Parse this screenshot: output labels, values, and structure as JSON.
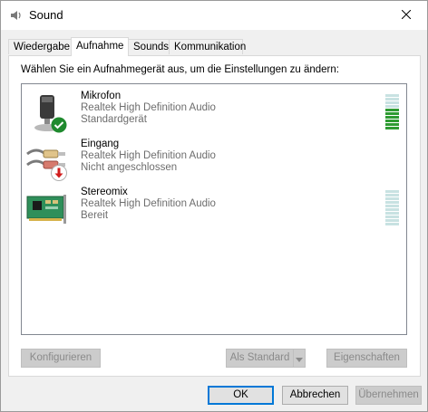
{
  "window": {
    "title": "Sound",
    "close_icon": "close-icon"
  },
  "tabs": [
    {
      "label": "Wiedergabe",
      "active": false
    },
    {
      "label": "Aufnahme",
      "active": true
    },
    {
      "label": "Sounds",
      "active": false
    },
    {
      "label": "Kommunikation",
      "active": false
    }
  ],
  "instruction": "Wählen Sie ein Aufnahmegerät aus, um die Einstellungen zu ändern:",
  "devices": [
    {
      "name": "Mikrofon",
      "driver": "Realtek High Definition Audio",
      "status": "Standardgerät",
      "icon": "microphone-icon",
      "badge": "green-check-badge",
      "level_active_bars": 6,
      "level_total_bars": 10
    },
    {
      "name": "Eingang",
      "driver": "Realtek High Definition Audio",
      "status": "Nicht angeschlossen",
      "icon": "line-in-cable-icon",
      "badge": "red-down-arrow-badge"
    },
    {
      "name": "Stereomix",
      "driver": "Realtek High Definition Audio",
      "status": "Bereit",
      "icon": "sound-card-icon",
      "level_active_bars": 0,
      "level_total_bars": 10
    }
  ],
  "buttons": {
    "configure": "Konfigurieren",
    "set_default": "Als Standard",
    "properties": "Eigenschaften",
    "ok": "OK",
    "cancel": "Abbrechen",
    "apply": "Übernehmen"
  },
  "colors": {
    "meter_active": "#2e9b32",
    "meter_inactive": "#c8e2e2",
    "focus_blue": "#0078d7"
  }
}
